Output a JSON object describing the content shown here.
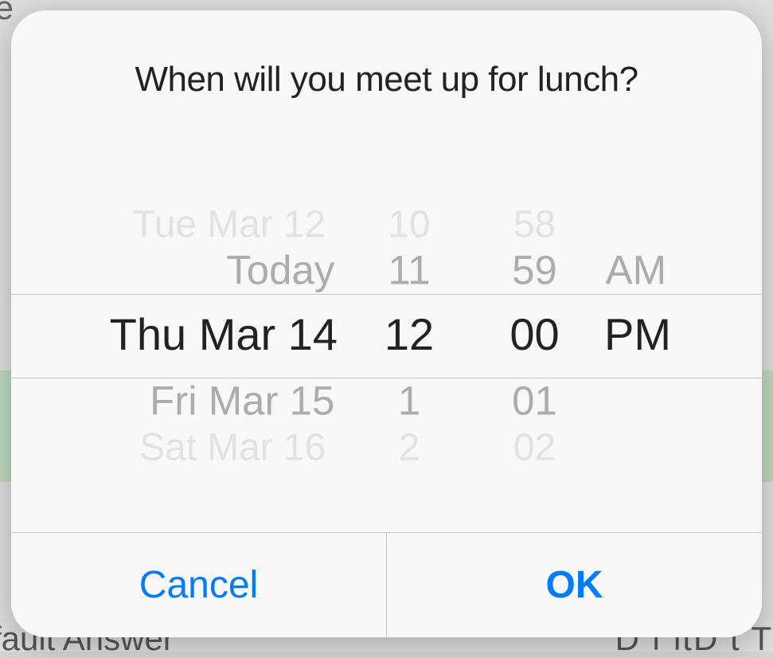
{
  "background": {
    "topLeftFragment": "te",
    "bottomLeftFragment": "fault Answer",
    "bottomRightFragment": "D    f    ltD  t  Ti"
  },
  "modal": {
    "title": "When will you meet up for lunch?",
    "picker": {
      "date": {
        "m2": "Tue Mar 12",
        "m1": "Today",
        "selected": "Thu Mar 14",
        "p1": "Fri Mar 15",
        "p2": "Sat Mar 16"
      },
      "hour": {
        "m2": "10",
        "m1": "11",
        "selected": "12",
        "p1": "1",
        "p2": "2"
      },
      "minute": {
        "m2": "58",
        "m1": "59",
        "selected": "00",
        "p1": "01",
        "p2": "02"
      },
      "period": {
        "m1": "AM",
        "selected": "PM"
      }
    },
    "buttons": {
      "cancel": "Cancel",
      "ok": "OK"
    }
  }
}
